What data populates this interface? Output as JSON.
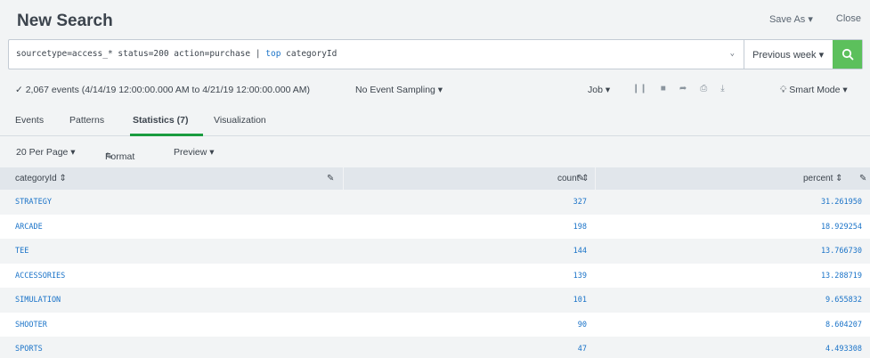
{
  "header": {
    "title": "New Search",
    "save_as": "Save As ▾",
    "close": "Close"
  },
  "search": {
    "query_prefix": "sourcetype=access_* status=200 action=purchase | ",
    "query_command": "top",
    "query_suffix": " categoryId",
    "time_range": "Previous week ▾"
  },
  "status": {
    "events": "✓ 2,067 events (4/14/19 12:00:00.000 AM to 4/21/19 12:00:00.000 AM)",
    "sampling": "No Event Sampling ▾",
    "job": "Job ▾",
    "mode": "Smart Mode ▾"
  },
  "tabs": [
    {
      "label": "Events"
    },
    {
      "label": "Patterns"
    },
    {
      "label": "Statistics (7)"
    },
    {
      "label": "Visualization"
    }
  ],
  "toolbar": {
    "per_page": "20 Per Page ▾",
    "format": "Format",
    "preview": "Preview ▾"
  },
  "table": {
    "columns": [
      "categoryId ⇕",
      "count ⇕",
      "percent ⇕"
    ],
    "rows": [
      [
        "STRATEGY",
        "327",
        "31.261950"
      ],
      [
        "ARCADE",
        "198",
        "18.929254"
      ],
      [
        "TEE",
        "144",
        "13.766730"
      ],
      [
        "ACCESSORIES",
        "139",
        "13.288719"
      ],
      [
        "SIMULATION",
        "101",
        "9.655832"
      ],
      [
        "SHOOTER",
        "90",
        "8.604207"
      ],
      [
        "SPORTS",
        "47",
        "4.493308"
      ]
    ]
  },
  "colors": {
    "accent": "#1a9c3f",
    "link": "#1a73c8",
    "search_button": "#5cc05c"
  }
}
